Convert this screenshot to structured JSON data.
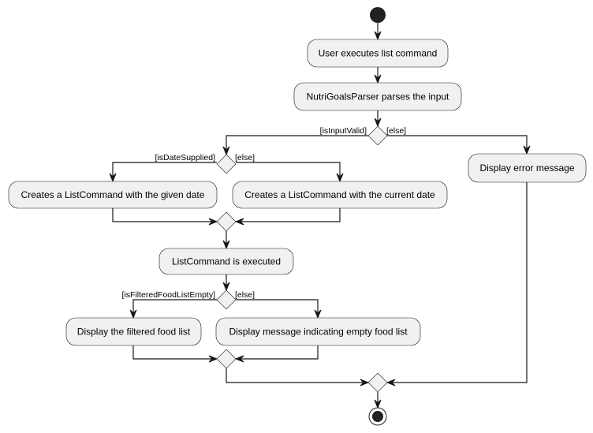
{
  "diagram": {
    "type": "activity",
    "nodes": {
      "start": {
        "kind": "start"
      },
      "user_executes": {
        "kind": "action",
        "label": "User executes list command"
      },
      "parser_parses": {
        "kind": "action",
        "label": "NutriGoalsParser parses the input"
      },
      "dec_input_valid": {
        "kind": "decision",
        "guard_true": "[isInputValid]",
        "guard_false": "[else]"
      },
      "dec_date_supplied": {
        "kind": "decision",
        "guard_true": "[isDateSupplied]",
        "guard_false": "[else]"
      },
      "create_given_date": {
        "kind": "action",
        "label": "Creates a ListCommand with the given date"
      },
      "create_current_date": {
        "kind": "action",
        "label": "Creates a ListCommand with the current date"
      },
      "merge_date": {
        "kind": "merge"
      },
      "list_executed": {
        "kind": "action",
        "label": "ListCommand is executed"
      },
      "dec_list_empty": {
        "kind": "decision",
        "guard_true": "[isFilteredFoodListEmpty]",
        "guard_false": "[else]"
      },
      "display_filtered": {
        "kind": "action",
        "label": "Display the filtered food list"
      },
      "display_empty_msg": {
        "kind": "action",
        "label": "Display message indicating empty food list"
      },
      "merge_list": {
        "kind": "merge"
      },
      "display_error": {
        "kind": "action",
        "label": "Display error message"
      },
      "merge_final": {
        "kind": "merge"
      },
      "end": {
        "kind": "end"
      }
    },
    "edges": [
      [
        "start",
        "user_executes"
      ],
      [
        "user_executes",
        "parser_parses"
      ],
      [
        "parser_parses",
        "dec_input_valid"
      ],
      [
        "dec_input_valid",
        "dec_date_supplied",
        "[isInputValid]"
      ],
      [
        "dec_input_valid",
        "display_error",
        "[else]"
      ],
      [
        "dec_date_supplied",
        "create_given_date",
        "[isDateSupplied]"
      ],
      [
        "dec_date_supplied",
        "create_current_date",
        "[else]"
      ],
      [
        "create_given_date",
        "merge_date"
      ],
      [
        "create_current_date",
        "merge_date"
      ],
      [
        "merge_date",
        "list_executed"
      ],
      [
        "list_executed",
        "dec_list_empty"
      ],
      [
        "dec_list_empty",
        "display_filtered",
        "[isFilteredFoodListEmpty]"
      ],
      [
        "dec_list_empty",
        "display_empty_msg",
        "[else]"
      ],
      [
        "display_filtered",
        "merge_list"
      ],
      [
        "display_empty_msg",
        "merge_list"
      ],
      [
        "merge_list",
        "merge_final"
      ],
      [
        "display_error",
        "merge_final"
      ],
      [
        "merge_final",
        "end"
      ]
    ]
  }
}
